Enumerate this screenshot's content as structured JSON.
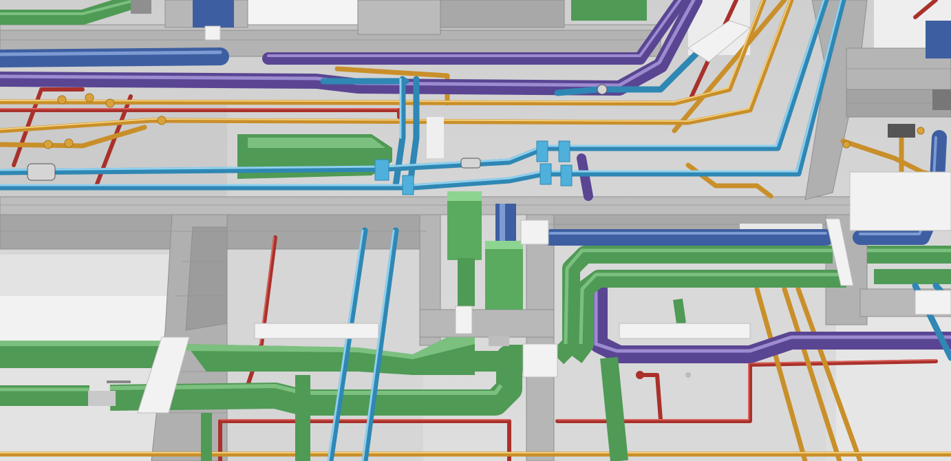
{
  "colors": {
    "floor": "#d4d4d4",
    "floor_shadow": "#bdbdbd",
    "wall": "#a9a9a9",
    "wall_top": "#bcbcbc",
    "wall_line": "#8e8e8e",
    "green_duct": "#4f9a55",
    "green_light": "#7cc07f",
    "blue_pipe": "#3f9bc9",
    "blue_light": "#8fd0ee",
    "purple_duct": "#6a55a6",
    "purple_light": "#9c8bd0",
    "navy_duct": "#3d5fa1",
    "navy_light": "#7d9bd3",
    "orange_pipe": "#d9a33b",
    "orange_light": "#f3cf7a",
    "red_pipe": "#a9312b",
    "red_light": "#d9615a",
    "sleeve": "#f2f2f2"
  }
}
